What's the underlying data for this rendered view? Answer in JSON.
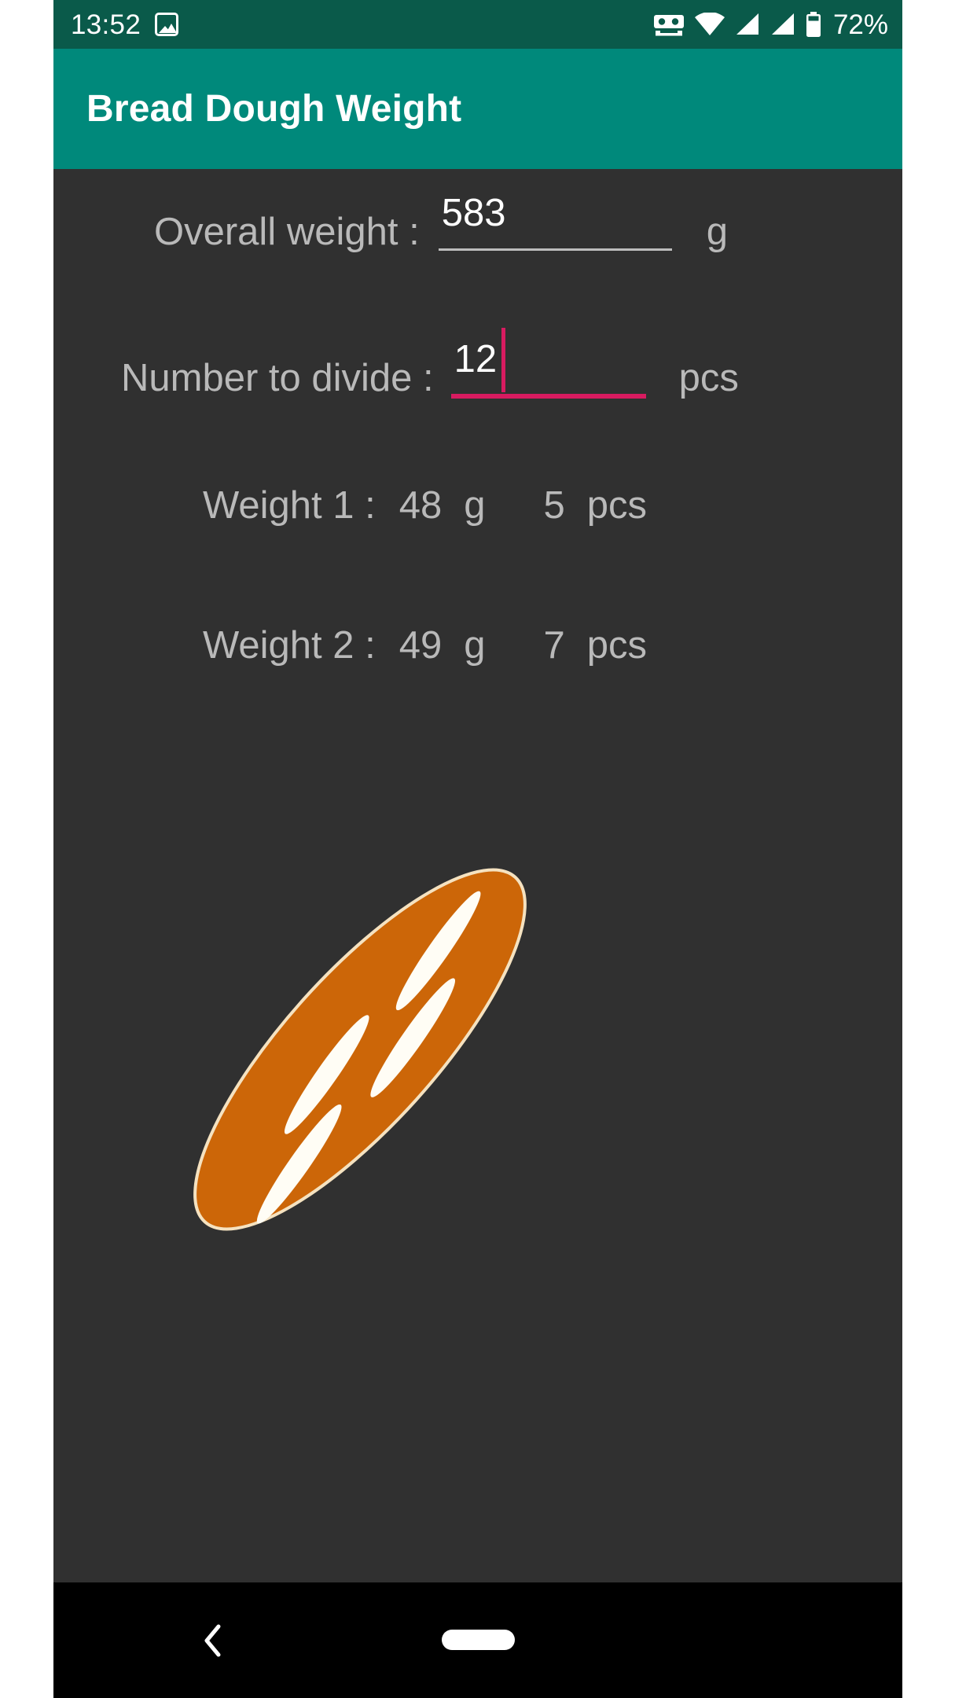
{
  "status_bar": {
    "time": "13:52",
    "battery_percent": "72%",
    "icons": [
      "gallery-icon",
      "vr-cardboard-icon",
      "wifi-icon",
      "cellular-signal-1-icon",
      "cellular-signal-2-icon",
      "battery-icon"
    ],
    "background_color": "#0a5a4a",
    "foreground_color": "#ffffff"
  },
  "app_bar": {
    "title": "Bread Dough Weight",
    "background_color": "#00897b",
    "title_color": "#ffffff"
  },
  "theme": {
    "content_background": "#303030",
    "label_color": "#b9b9b9",
    "value_color": "#ffffff",
    "accent_color": "#d81b60",
    "underline_color": "#bdbdbd",
    "bread_fill": "#cc6608",
    "bread_outline": "#f5e2c0",
    "bread_slash": "#fffdf5"
  },
  "form": {
    "overall_weight": {
      "label": "Overall weight :",
      "value": "583",
      "placeholder": "",
      "unit": "g",
      "focused": false
    },
    "number_to_divide": {
      "label": "Number to divide :",
      "value": "12",
      "placeholder": "",
      "unit": "pcs",
      "focused": true
    }
  },
  "results": [
    {
      "label": "Weight 1 :",
      "weight": "48",
      "weight_unit": "g",
      "count": "5",
      "count_unit": "pcs"
    },
    {
      "label": "Weight 2 :",
      "weight": "49",
      "weight_unit": "g",
      "count": "7",
      "count_unit": "pcs"
    }
  ],
  "illustration": {
    "name": "bread-loaf-illustration",
    "slash_count": 4
  },
  "nav_bar": {
    "back_label": "Back",
    "home_label": "Home",
    "background_color": "#000000"
  }
}
